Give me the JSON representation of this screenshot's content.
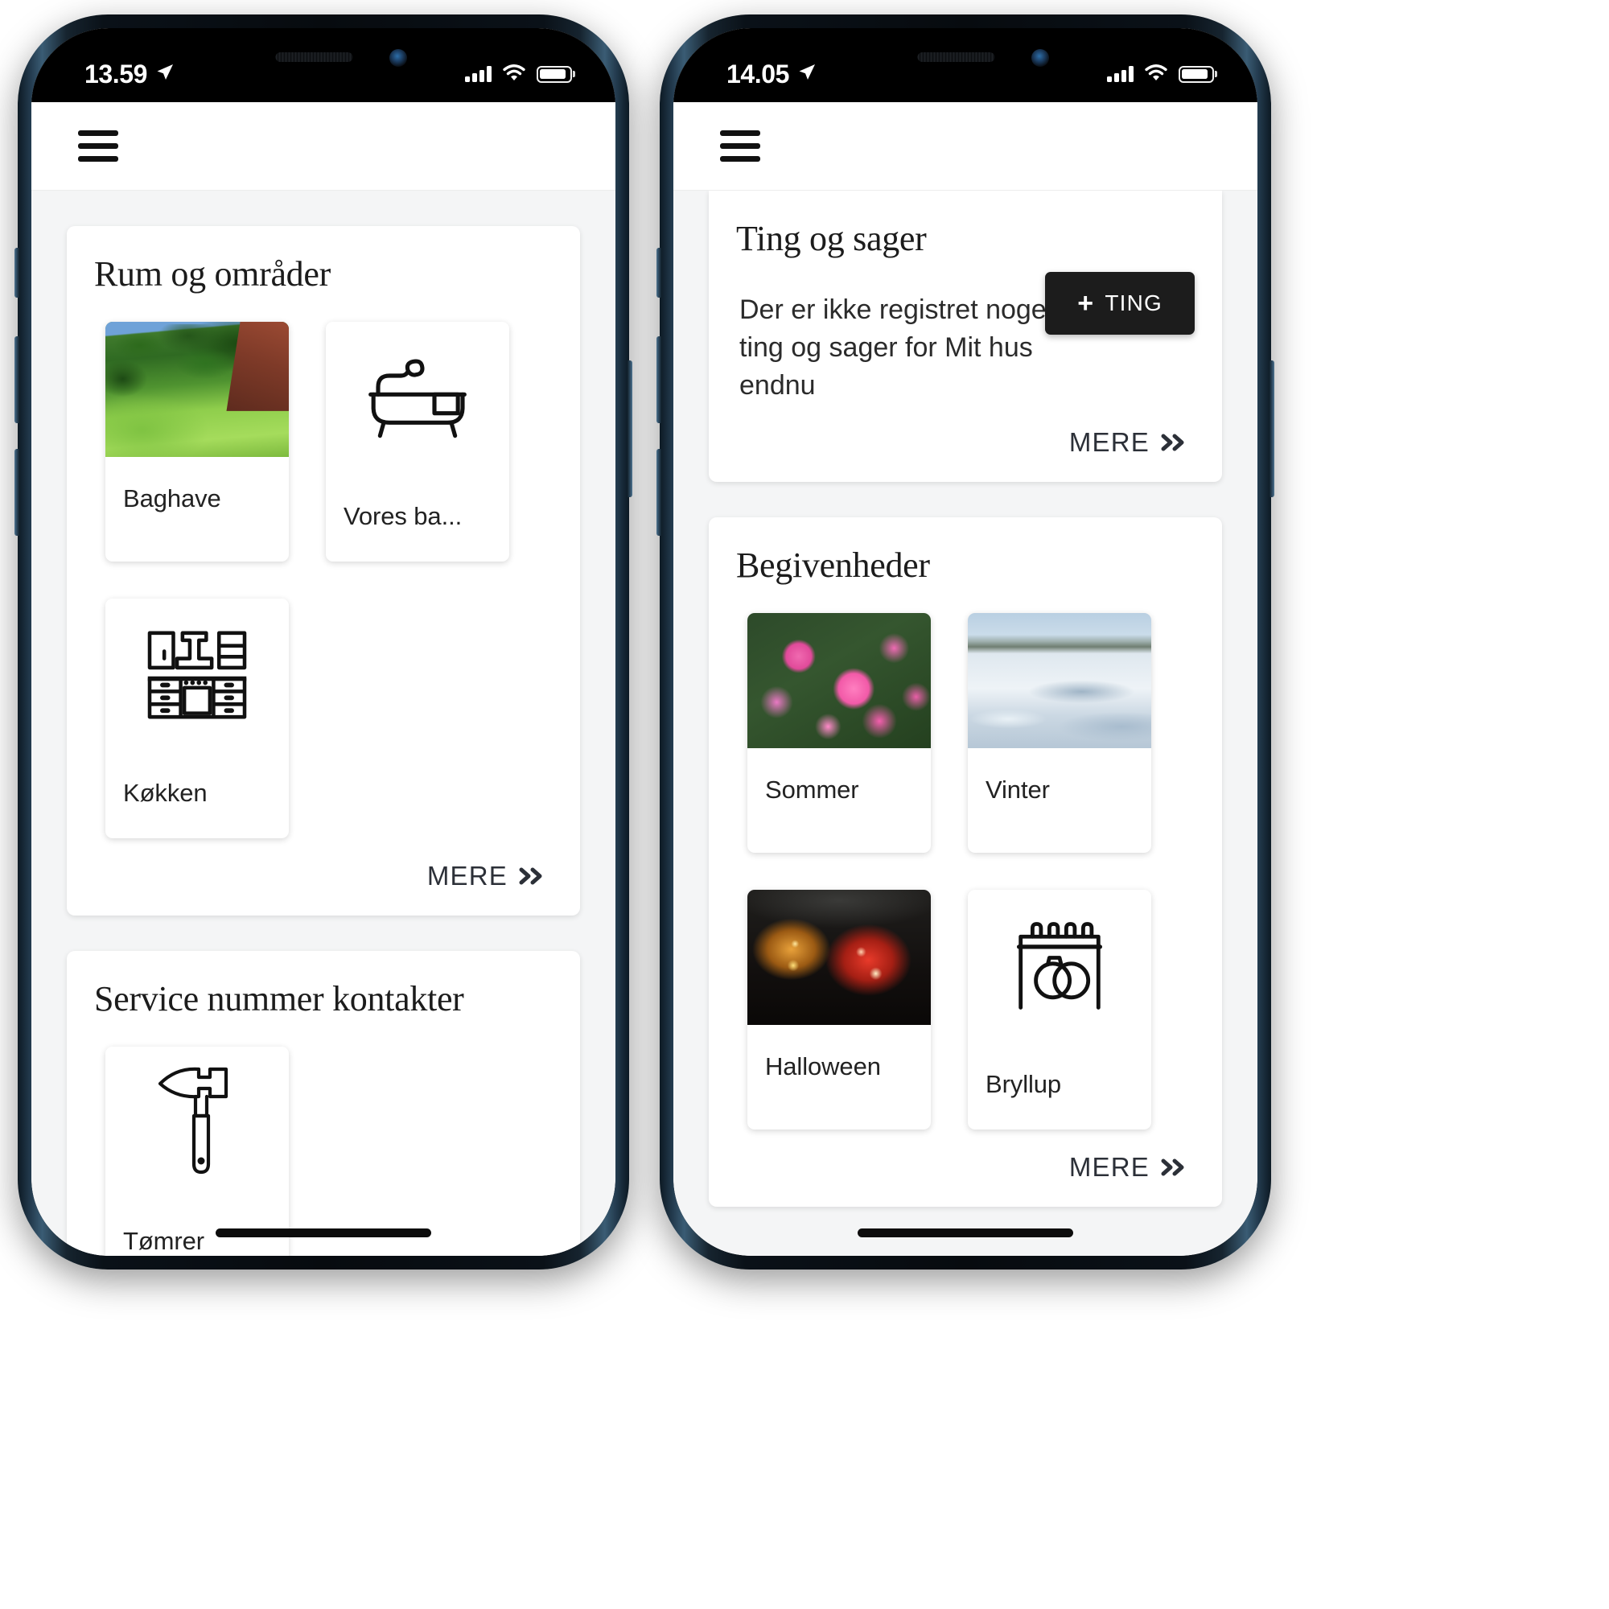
{
  "phones": [
    {
      "id": "left",
      "status": {
        "time": "13.59",
        "location_icon": "location-arrow-icon",
        "signal_icon": "cellular-signal-icon",
        "wifi_icon": "wifi-icon",
        "battery_icon": "battery-icon"
      },
      "appbar": {
        "menu_icon": "hamburger-menu-icon"
      },
      "cards": [
        {
          "title": "Rum og områder",
          "tiles": [
            {
              "label": "Baghave",
              "media": "photo",
              "photo": "garden-photo",
              "icon": null
            },
            {
              "label": "Vores ba...",
              "media": "icon",
              "photo": null,
              "icon": "bathtub-icon"
            },
            {
              "label": "Køkken",
              "media": "icon",
              "photo": null,
              "icon": "kitchen-icon"
            }
          ],
          "more_label": "MERE"
        },
        {
          "title": "Service nummer kontakter",
          "tiles": [
            {
              "label": "Tømrer",
              "media": "icon",
              "photo": null,
              "icon": "hammer-icon"
            }
          ],
          "more_label": null
        }
      ]
    },
    {
      "id": "right",
      "status": {
        "time": "14.05",
        "location_icon": "location-arrow-icon",
        "signal_icon": "cellular-signal-icon",
        "wifi_icon": "wifi-icon",
        "battery_icon": "battery-icon"
      },
      "appbar": {
        "menu_icon": "hamburger-menu-icon"
      },
      "cards": [
        {
          "title": "Ting og sager",
          "empty_text": "Der er ikke registret nogen ting og sager for Mit hus endnu",
          "add_button": {
            "label": "TING",
            "plus": "+"
          },
          "more_label": "MERE"
        },
        {
          "title": "Begivenheder",
          "tiles": [
            {
              "label": "Sommer",
              "media": "photo",
              "photo": "flowers-photo",
              "icon": null
            },
            {
              "label": "Vinter",
              "media": "photo",
              "photo": "snow-photo",
              "icon": null
            },
            {
              "label": "Halloween",
              "media": "photo",
              "photo": "pumpkin-photo",
              "icon": null
            },
            {
              "label": "Bryllup",
              "media": "icon",
              "photo": null,
              "icon": "wedding-rings-calendar-icon"
            }
          ],
          "more_label": "MERE"
        }
      ]
    }
  ],
  "colors": {
    "accent_dark": "#1c1c1c",
    "page_background": "#f4f5f6",
    "card_background": "#ffffff",
    "text_primary": "#1c1c1c",
    "frame": "#13222d"
  }
}
